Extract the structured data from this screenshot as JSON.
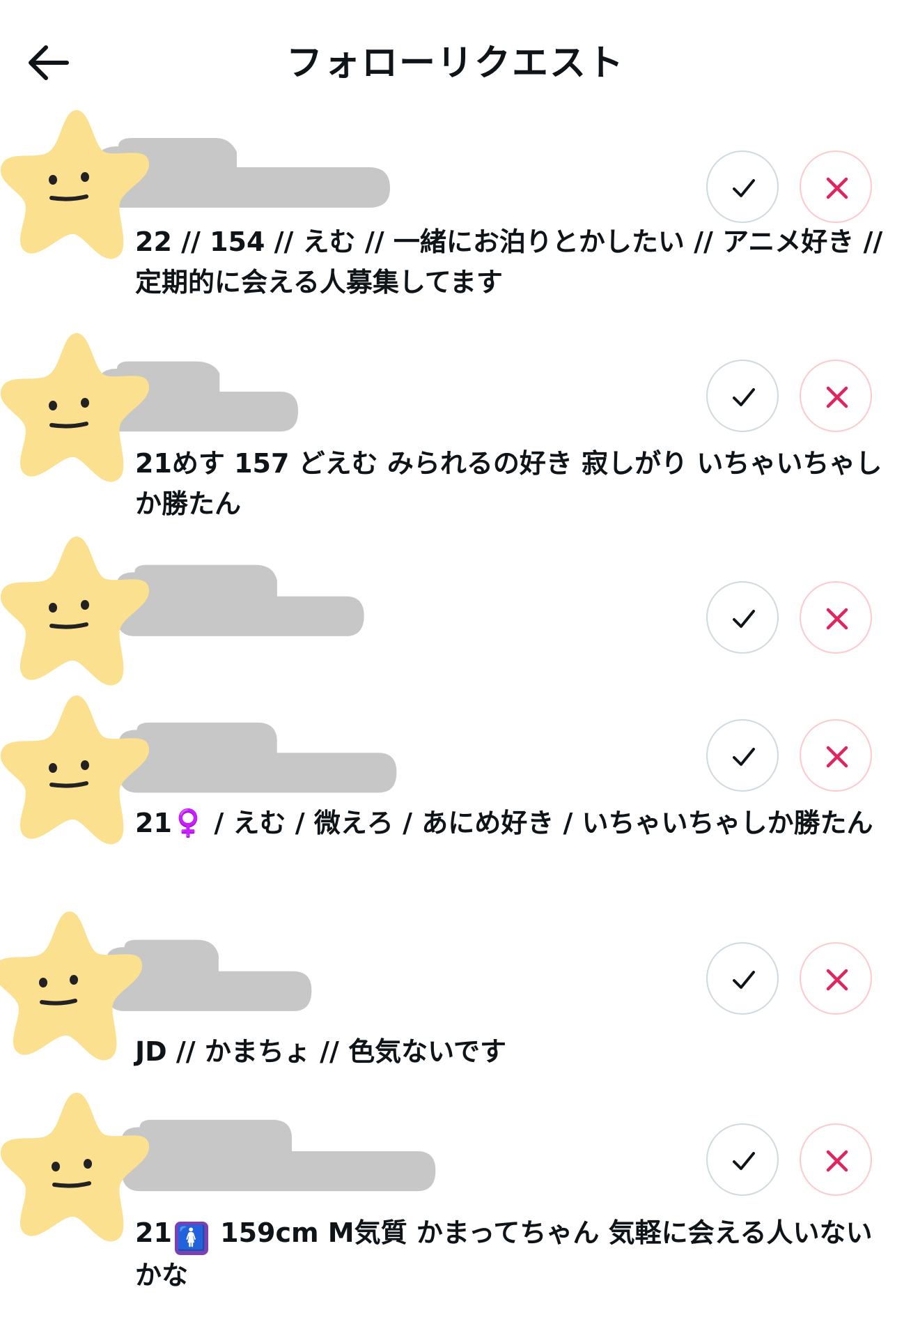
{
  "header": {
    "title": "フォローリクエスト",
    "back_icon": "arrow-left-icon"
  },
  "colors": {
    "avatar_fill": "#fbe08f",
    "blur_fill": "#c7c7c7",
    "accept_border": "#cfd9de",
    "reject_border": "#fdc9ce",
    "reject_icon": "#e0245e",
    "text": "#0f1419"
  },
  "requests": [
    {
      "bio": "22 // 154 // えむ // 一緒にお泊りとかしたい // アニメ好き // 定期的に会える人募集してます"
    },
    {
      "bio": "21めす 157 どえむ みられるの好き 寂しがり いちゃいちゃしか勝たん"
    },
    {
      "bio": ""
    },
    {
      "bio": "21♀️ / えむ / 微えろ / あにめ好き / いちゃいちゃしか勝たん"
    },
    {
      "bio": "JD // かまちょ // 色気ないです"
    },
    {
      "bio_prefix": "21",
      "bio_emoji": "🚺",
      "bio": "159cm M気質 かまってちゃん 気軽に会える人いないかな"
    }
  ]
}
